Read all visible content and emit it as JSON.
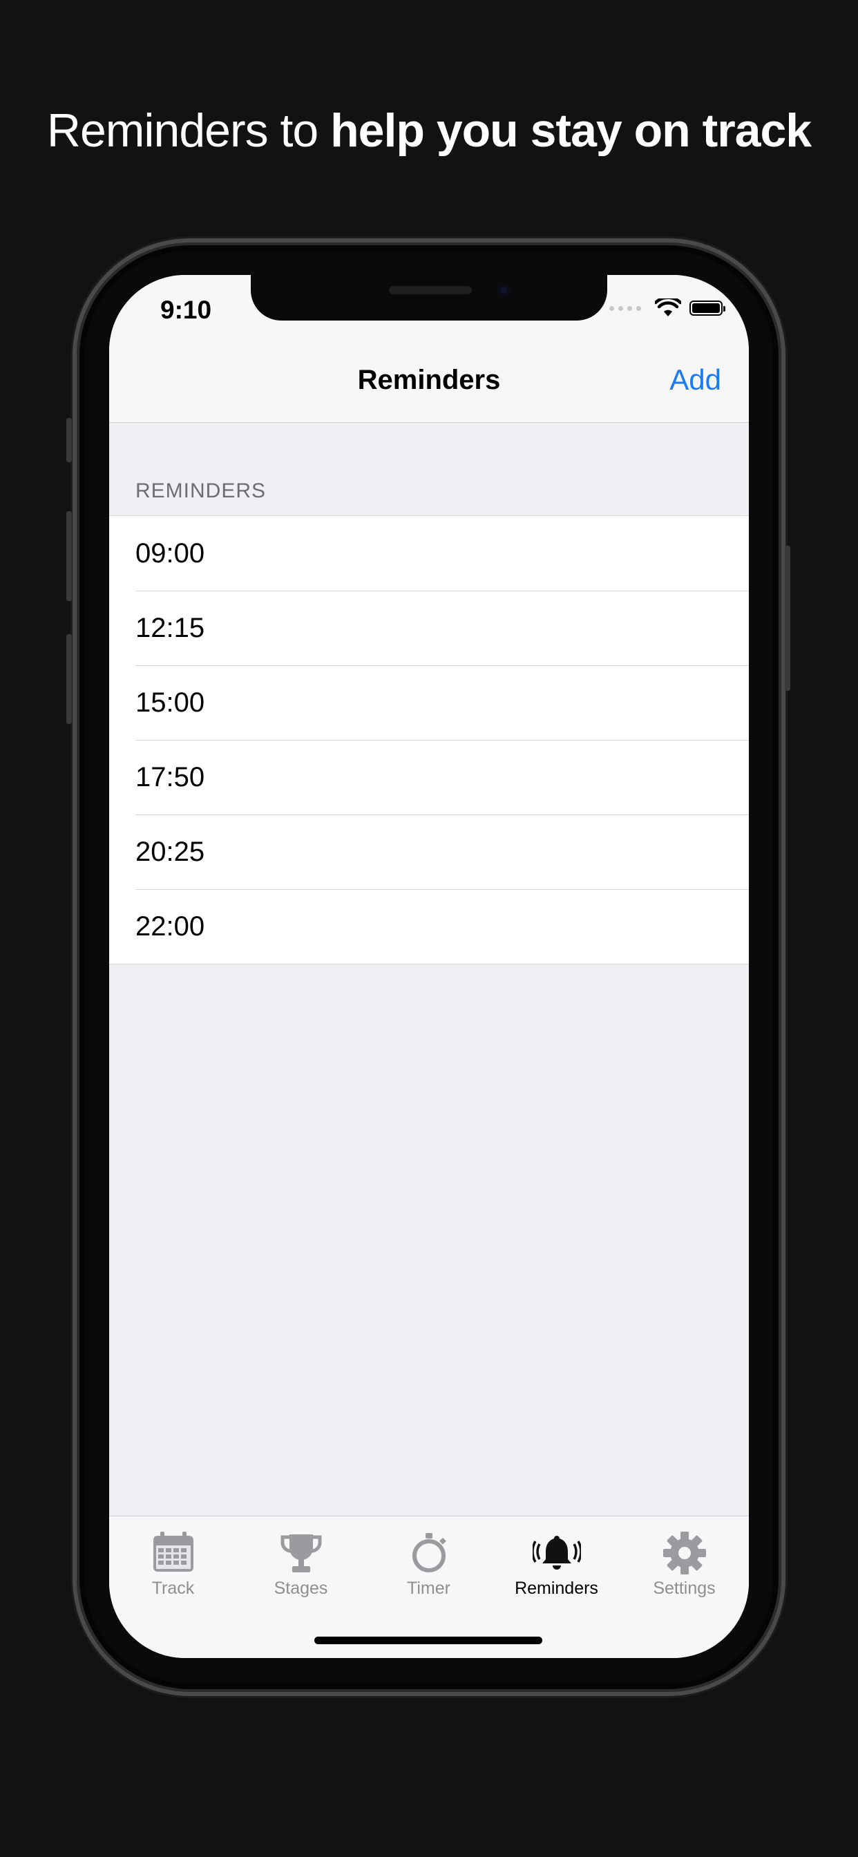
{
  "headline": {
    "regular": "Reminders to ",
    "bold": "help you stay on track"
  },
  "status_bar": {
    "time": "9:10"
  },
  "navbar": {
    "title": "Reminders",
    "add_label": "Add"
  },
  "section": {
    "header": "REMINDERS"
  },
  "reminders": [
    "09:00",
    "12:15",
    "15:00",
    "17:50",
    "20:25",
    "22:00"
  ],
  "tabs": [
    {
      "label": "Track",
      "icon": "calendar-icon",
      "active": false
    },
    {
      "label": "Stages",
      "icon": "trophy-icon",
      "active": false
    },
    {
      "label": "Timer",
      "icon": "stopwatch-icon",
      "active": false
    },
    {
      "label": "Reminders",
      "icon": "bell-icon",
      "active": true
    },
    {
      "label": "Settings",
      "icon": "gear-icon",
      "active": false
    }
  ],
  "colors": {
    "accent": "#1a7cf4",
    "tab_inactive": "#8e8e93",
    "background": "#121212"
  }
}
